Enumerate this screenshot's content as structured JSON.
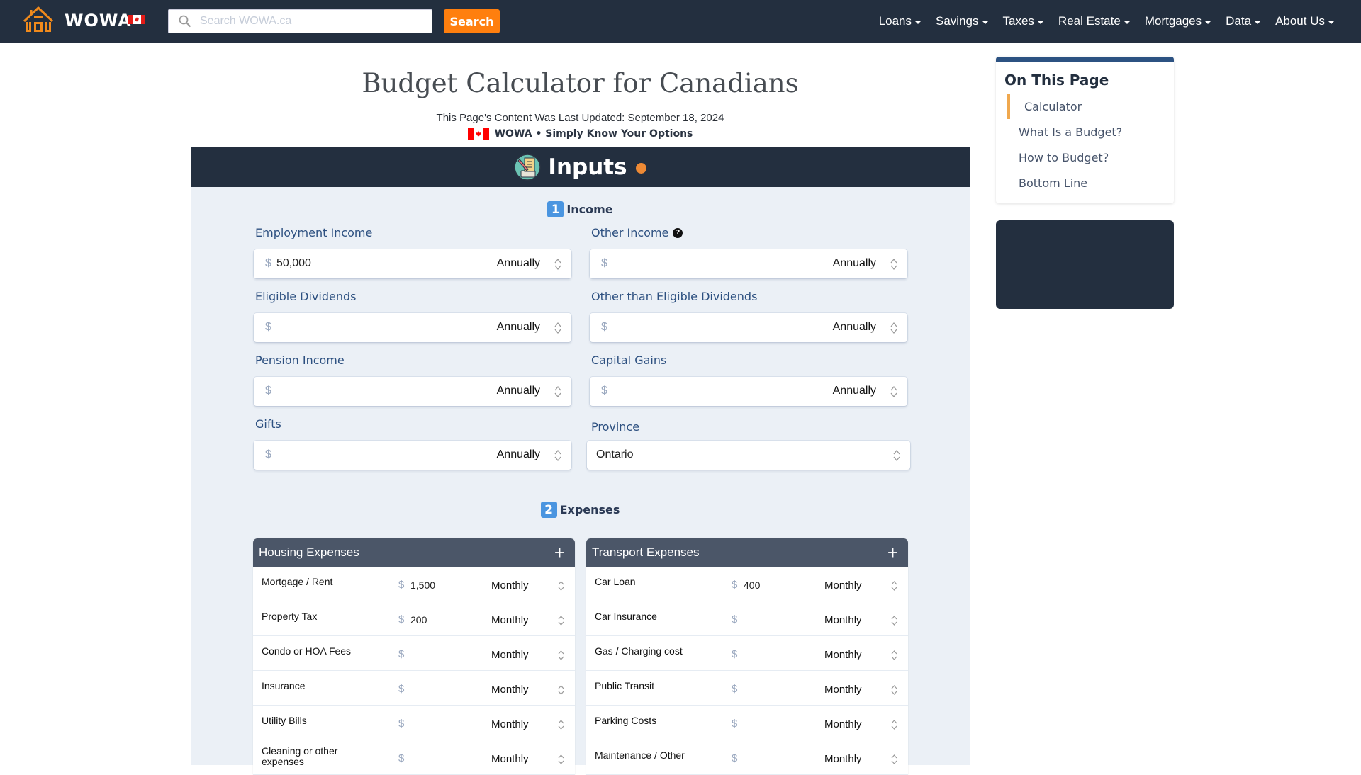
{
  "header": {
    "brand": "WOWA",
    "search_placeholder": "Search WOWA.ca",
    "search_value": "",
    "search_button": "Search",
    "nav": [
      {
        "label": "Loans"
      },
      {
        "label": "Savings"
      },
      {
        "label": "Taxes"
      },
      {
        "label": "Real Estate"
      },
      {
        "label": "Mortgages"
      },
      {
        "label": "Data"
      },
      {
        "label": "About Us"
      }
    ]
  },
  "page": {
    "title": "Budget Calculator for Canadians",
    "updated": "This Page's Content Was Last Updated: September 18, 2024",
    "tagline": "WOWA • Simply Know Your Options"
  },
  "calculator": {
    "header_title": "Inputs",
    "income": {
      "step": "1",
      "heading": "Income",
      "fields": [
        {
          "label": "Employment Income",
          "currency": "$",
          "value": "50,000",
          "frequency": "Annually"
        },
        {
          "label": "Other Income",
          "currency": "$",
          "value": "",
          "frequency": "Annually",
          "help": "?"
        },
        {
          "label": "Eligible Dividends",
          "currency": "$",
          "value": "",
          "frequency": "Annually"
        },
        {
          "label": "Other than Eligible Dividends",
          "currency": "$",
          "value": "",
          "frequency": "Annually"
        },
        {
          "label": "Pension Income",
          "currency": "$",
          "value": "",
          "frequency": "Annually"
        },
        {
          "label": "Capital Gains",
          "currency": "$",
          "value": "",
          "frequency": "Annually"
        },
        {
          "label": "Gifts",
          "currency": "$",
          "value": "",
          "frequency": "Annually"
        }
      ],
      "province": {
        "label": "Province",
        "value": "Ontario"
      }
    },
    "expenses": {
      "step": "2",
      "heading": "Expenses",
      "housing": {
        "title": "Housing Expenses",
        "rows": [
          {
            "label": "Mortgage / Rent",
            "currency": "$",
            "value": "1,500",
            "frequency": "Monthly"
          },
          {
            "label": "Property Tax",
            "currency": "$",
            "value": "200",
            "frequency": "Monthly"
          },
          {
            "label": "Condo or HOA Fees",
            "currency": "$",
            "value": "",
            "frequency": "Monthly"
          },
          {
            "label": "Insurance",
            "currency": "$",
            "value": "",
            "frequency": "Monthly"
          },
          {
            "label": "Utility Bills",
            "currency": "$",
            "value": "",
            "frequency": "Monthly"
          },
          {
            "label": "Cleaning or other expenses",
            "currency": "$",
            "value": "",
            "frequency": "Monthly"
          }
        ]
      },
      "transport": {
        "title": "Transport Expenses",
        "rows": [
          {
            "label": "Car Loan",
            "currency": "$",
            "value": "400",
            "frequency": "Monthly"
          },
          {
            "label": "Car Insurance",
            "currency": "$",
            "value": "",
            "frequency": "Monthly"
          },
          {
            "label": "Gas / Charging cost",
            "currency": "$",
            "value": "",
            "frequency": "Monthly"
          },
          {
            "label": "Public Transit",
            "currency": "$",
            "value": "",
            "frequency": "Monthly"
          },
          {
            "label": "Parking Costs",
            "currency": "$",
            "value": "",
            "frequency": "Monthly"
          },
          {
            "label": "Maintenance / Other",
            "currency": "$",
            "value": "",
            "frequency": "Monthly"
          }
        ]
      }
    }
  },
  "sidebar": {
    "title": "On This Page",
    "items": [
      {
        "label": "Calculator",
        "active": true
      },
      {
        "label": "What Is a Budget?"
      },
      {
        "label": "How to Budget?"
      },
      {
        "label": "Bottom Line"
      }
    ]
  },
  "colors": {
    "navbar": "#232f3f",
    "accent_orange": "#ff7f0e",
    "card_bg": "#ebf0f6",
    "label_blue": "#2d5080",
    "step_badge": "#4a95e0",
    "panel_header": "#4b5668",
    "toc_active_bar": "#f0a84e"
  }
}
